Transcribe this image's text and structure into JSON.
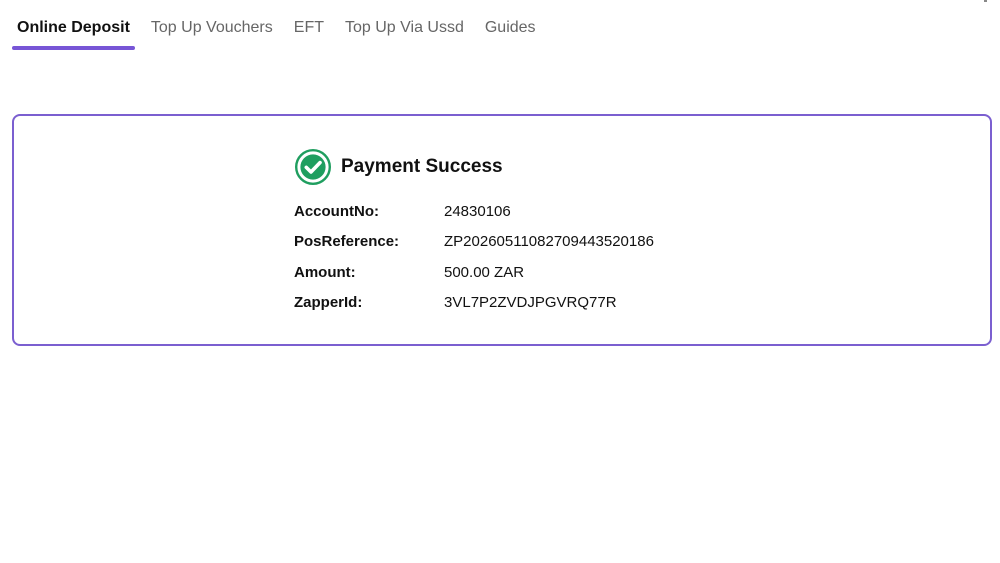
{
  "tabs": [
    {
      "label": "Online Deposit",
      "active": true
    },
    {
      "label": "Top Up Vouchers",
      "active": false
    },
    {
      "label": "EFT",
      "active": false
    },
    {
      "label": "Top Up Via Ussd",
      "active": false
    },
    {
      "label": "Guides",
      "active": false
    }
  ],
  "colors": {
    "accent": "#7755d6",
    "success": "#1f9e5f"
  },
  "payment": {
    "icon": "check-circle-icon",
    "title": "Payment Success",
    "fields": [
      {
        "label": "AccountNo:",
        "value": "24830106"
      },
      {
        "label": "PosReference:",
        "value": "ZP2026051108270944352018​6"
      },
      {
        "label": "Amount:",
        "value": "500.00 ZAR"
      },
      {
        "label": "ZapperId:",
        "value": "3VL7P2ZVDJPGVRQ77R"
      }
    ]
  }
}
